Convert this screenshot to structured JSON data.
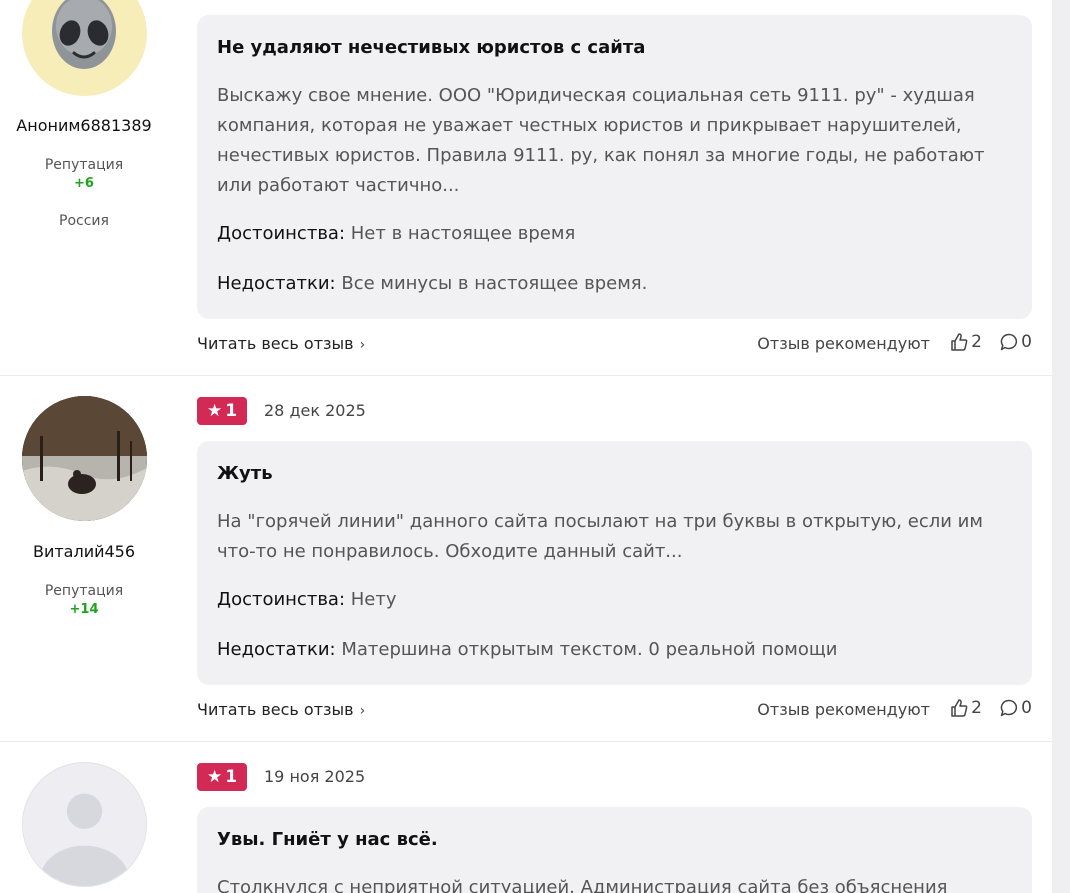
{
  "reviews": [
    {
      "user": {
        "name": "Аноним6881389",
        "reputation_label": "Репутация",
        "reputation_value": "+6",
        "country": "Россия",
        "avatar": "alien-avatar"
      },
      "title": "Не удаляют нечестивых юристов с сайта",
      "body": "Выскажу свое мнение. ООО \"Юридическая социальная сеть 9111. ру\" - худшая компания, которая не уважает честных юристов и прикрывает нарушителей, нечестивых юристов. Правила 9111. ру, как понял за многие годы, не работают или работают частично...",
      "pros_label": "Достоинства:",
      "pros": "Нет в настоящее время",
      "cons_label": "Недостатки:",
      "cons": "Все минусы в настоящее время.",
      "read_more": "Читать весь отзыв",
      "recommend": "Отзыв рекомендуют",
      "likes": "2",
      "comments": "0"
    },
    {
      "user": {
        "name": "Виталий456",
        "reputation_label": "Репутация",
        "reputation_value": "+14",
        "avatar": "photo-avatar"
      },
      "rating": "1",
      "date": "28 дек 2025",
      "title": "Жуть",
      "body": "На \"горячей линии\" данного сайта посылают на три буквы в открытую, если им что-то не понравилось. Обходите данный сайт...",
      "pros_label": "Достоинства:",
      "pros": "Нету",
      "cons_label": "Недостатки:",
      "cons": "Матершина открытым текстом. 0 реальной помощи",
      "read_more": "Читать весь отзыв",
      "recommend": "Отзыв рекомендуют",
      "likes": "2",
      "comments": "0"
    },
    {
      "user": {
        "avatar": "default-avatar"
      },
      "rating": "1",
      "date": "19 ноя 2025",
      "title": "Увы. Гниёт у нас всё.",
      "body": "Столкнулся с неприятной ситуацией. Администрация сайта без объяснения"
    }
  ],
  "colors": {
    "rating_badge": "#d32a55",
    "reputation": "#1ea31e",
    "card_bg": "#f1f1f4"
  }
}
